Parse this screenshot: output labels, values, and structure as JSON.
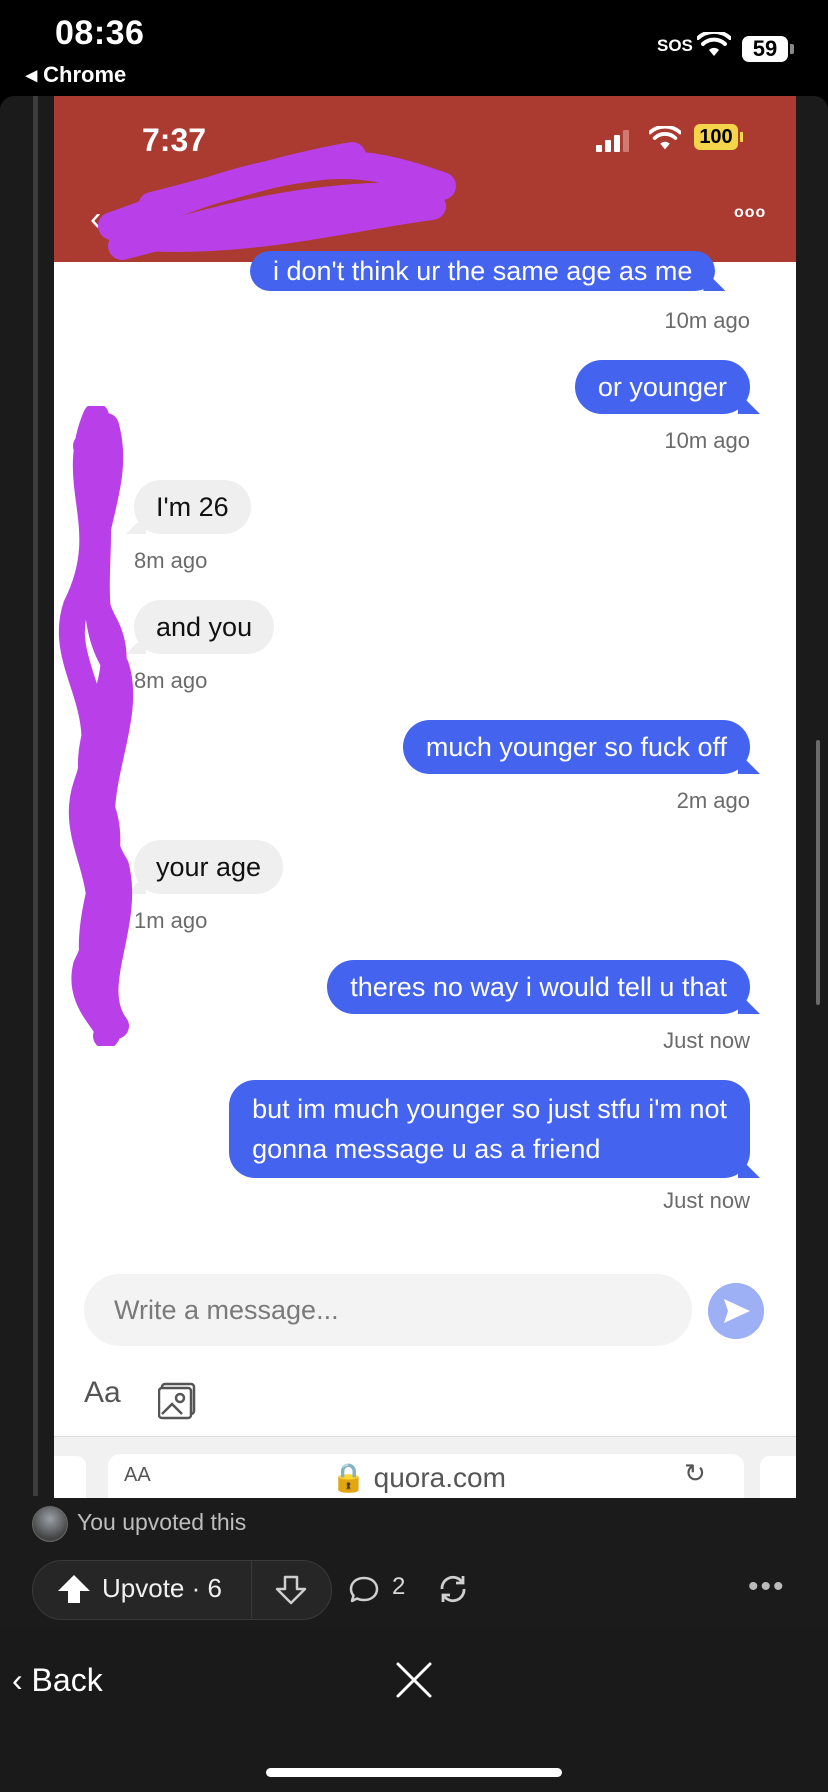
{
  "outer_status": {
    "time": "08:36",
    "back_app": "◂ Chrome",
    "sos": "SOS",
    "battery": "59"
  },
  "screenshot": {
    "status": {
      "time": "7:37",
      "battery": "100"
    },
    "header": {
      "back": "‹",
      "more": "ooo"
    },
    "messages": [
      {
        "dir": "out",
        "text": "i don't think ur the same age as me",
        "time": "10m ago"
      },
      {
        "dir": "out",
        "text": "or younger",
        "time": "10m ago"
      },
      {
        "dir": "in",
        "text": "I'm 26",
        "time": "8m ago"
      },
      {
        "dir": "in",
        "text": "and you",
        "time": "8m ago"
      },
      {
        "dir": "out",
        "text": "much younger so fuck off",
        "time": "2m ago"
      },
      {
        "dir": "in",
        "text": "your age",
        "time": "1m ago"
      },
      {
        "dir": "out",
        "text": "theres no way i would tell u that",
        "time": "Just now"
      },
      {
        "dir": "out",
        "text_line1": "but im much younger so just stfu i'm not",
        "text_line2": "gonna message u as a friend",
        "time": "Just now"
      }
    ],
    "composer": {
      "placeholder": "Write a message...",
      "format_label": "Aa"
    },
    "url_bar": {
      "aa": "AA",
      "domain": "🔒 quora.com",
      "share": "↻"
    }
  },
  "post_footer": {
    "upvoted_text": "You upvoted this",
    "upvote_label": "Upvote · 6",
    "comment_count": "2",
    "more": "•••"
  },
  "bottom_nav": {
    "back_label": "Back"
  },
  "colors": {
    "header_red": "#ab3a30",
    "bubble_blue": "#4463ef",
    "scribble_purple": "#b93fe8"
  }
}
